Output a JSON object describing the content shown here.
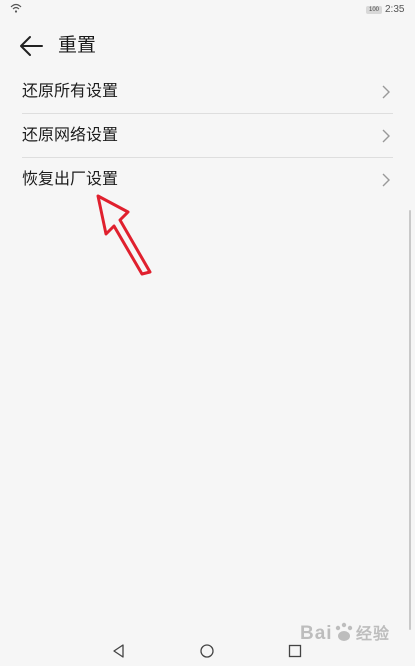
{
  "status_bar": {
    "time": "2:35",
    "battery": "100"
  },
  "header": {
    "title": "重置",
    "back_icon": "back-arrow-icon"
  },
  "reset_options": [
    {
      "label": "还原所有设置",
      "icon": "chevron-right-icon"
    },
    {
      "label": "还原网络设置",
      "icon": "chevron-right-icon"
    },
    {
      "label": "恢复出厂设置",
      "icon": "chevron-right-icon"
    }
  ],
  "annotation": {
    "color": "#e0202e",
    "points_to": "恢复出厂设置"
  },
  "nav_bar": {
    "icons": [
      "nav-back-icon",
      "nav-home-icon",
      "nav-recents-icon"
    ]
  },
  "watermark": {
    "text": "Bai经验",
    "logo": "baidu-paw-logo"
  }
}
